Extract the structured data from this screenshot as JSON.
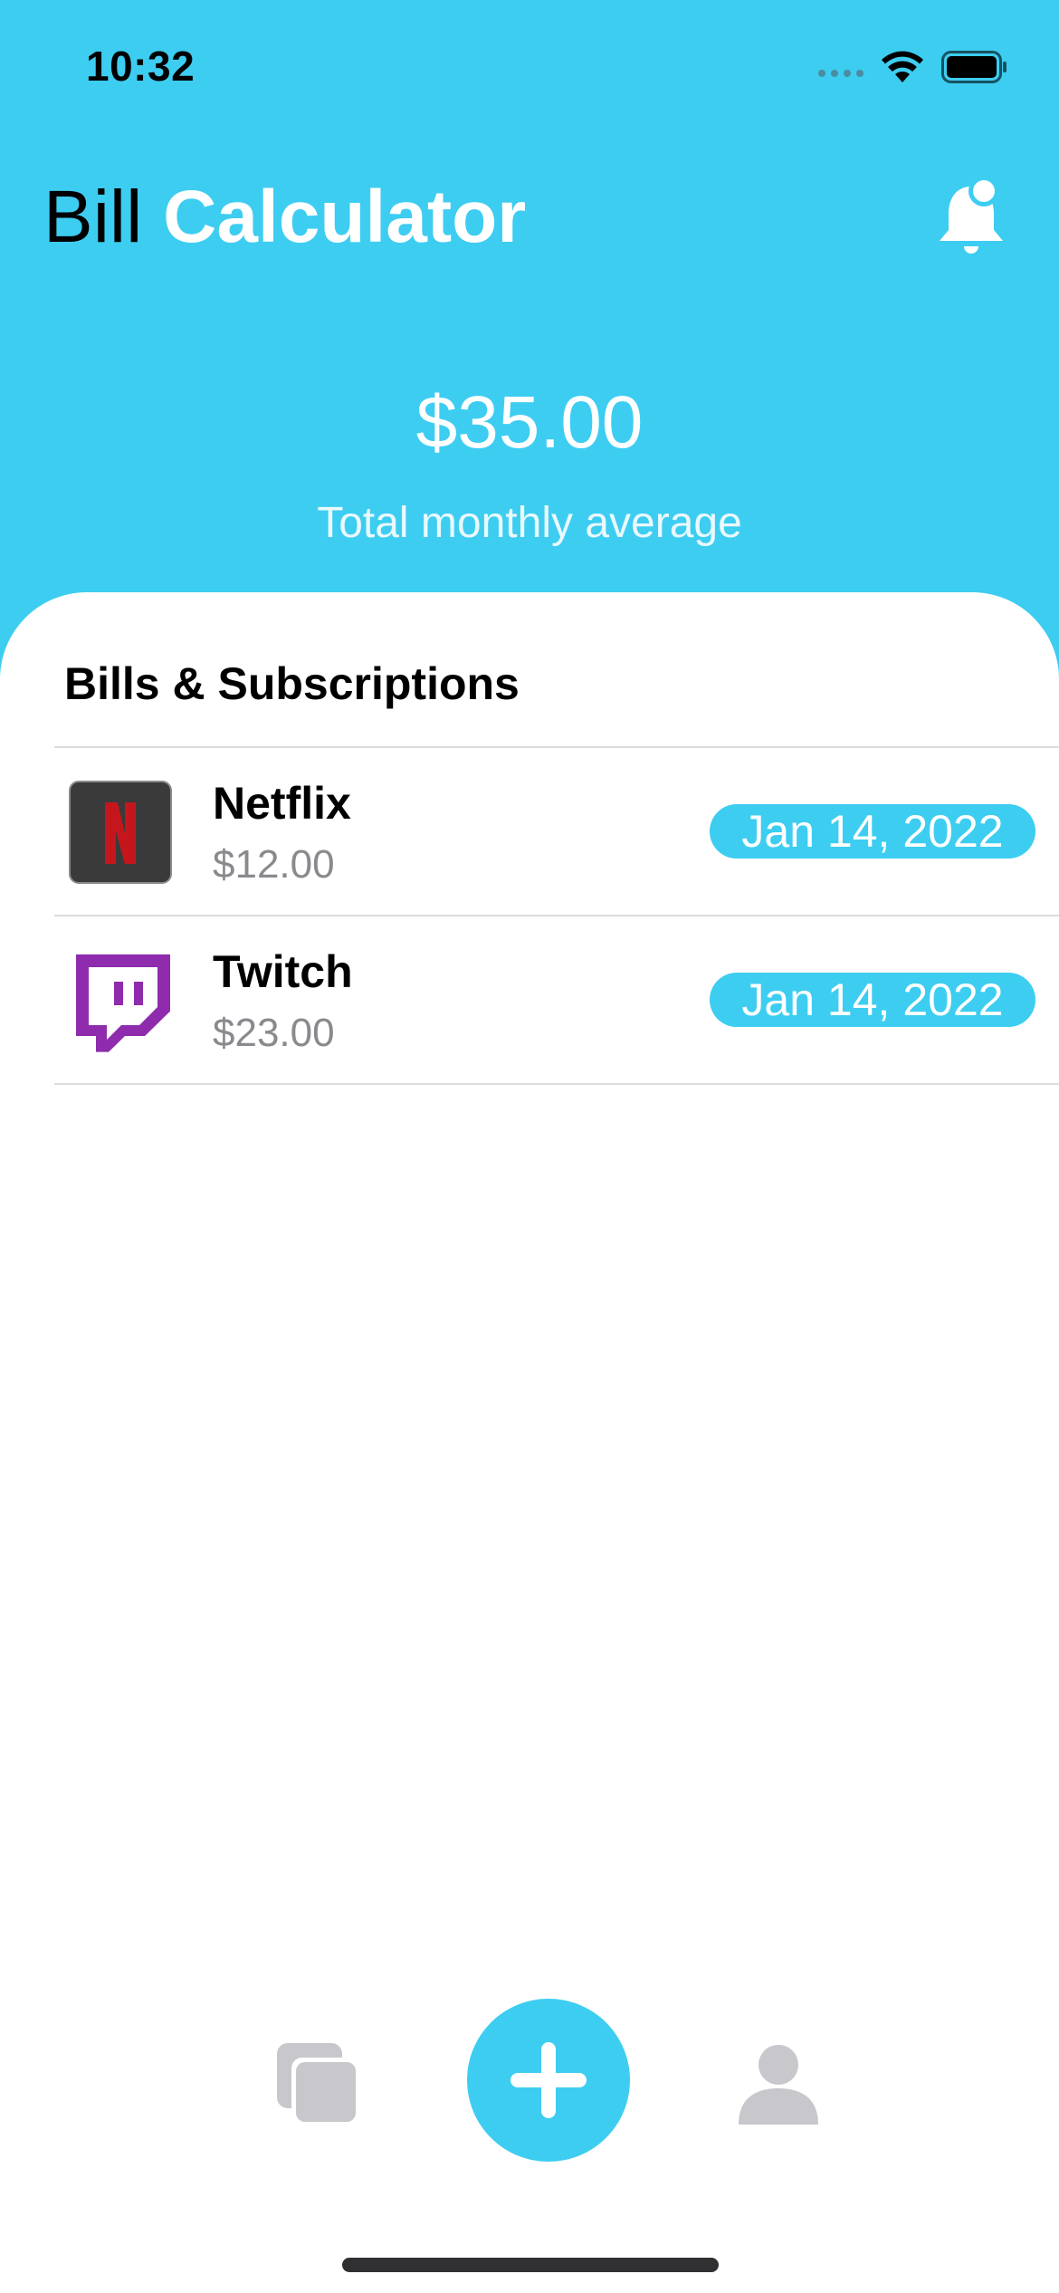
{
  "status_bar": {
    "time": "10:32"
  },
  "header": {
    "title_regular": "Bill",
    "title_bold": "Calculator"
  },
  "summary": {
    "amount": "$35.00",
    "label": "Total monthly average"
  },
  "section": {
    "title": "Bills & Subscriptions"
  },
  "bills": [
    {
      "name": "Netflix",
      "price": "$12.00",
      "date": "Jan 14, 2022",
      "icon": "netflix-logo"
    },
    {
      "name": "Twitch",
      "price": "$23.00",
      "date": "Jan 14, 2022",
      "icon": "twitch-logo"
    }
  ],
  "colors": {
    "accent": "#3dcdf1",
    "muted_text": "#8a8a8e",
    "tab_icon": "#c7c7cc"
  }
}
